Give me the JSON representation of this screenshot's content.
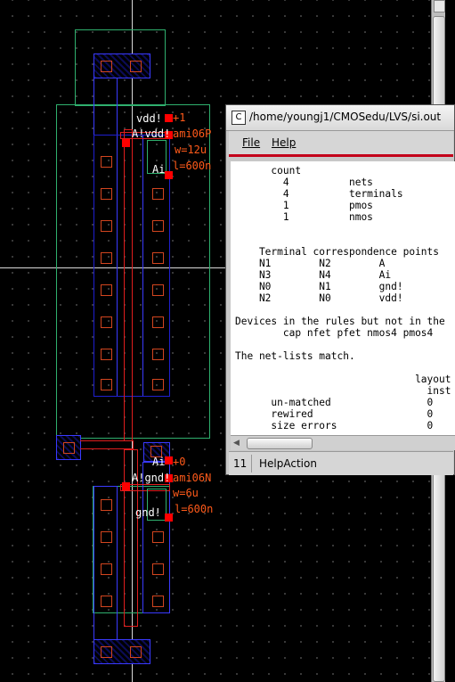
{
  "layout_labels": {
    "pmos_name": "vdd!",
    "pmos_index": "+1",
    "pmos_conn": "A!vdd!",
    "pmos_model": "ami06P",
    "pmos_width": "w=12u",
    "pmos_length": "l=600n",
    "pmos_gate": "Ai",
    "nmos_gate": "Ai",
    "nmos_index": "+0",
    "nmos_conn": "A!gnd!",
    "nmos_model": "ami06N",
    "nmos_width": "w=6u",
    "nmos_length": "l=600n",
    "nmos_name": "gnd!"
  },
  "window": {
    "title": "/home/youngj1/CMOSedu/LVS/si.out",
    "menu": {
      "file": "File",
      "help": "Help"
    },
    "content": "      count\n        4          nets\n        4          terminals\n        1          pmos\n        1          nmos\n\n\n    Terminal correspondence points\n    N1        N2        A\n    N3        N4        Ai\n    N0        N1        gnd!\n    N2        N0        vdd!\n\nDevices in the rules but not in the\n        cap nfet pfet nmos4 pmos4\n\nThe net-lists match.\n\n                              layout\n                                inst\n      un-matched                0\n      rewired                   0\n      size errors               0",
    "status_number": "11",
    "status_text": "HelpAction"
  },
  "colors": {
    "nwell": "#2fb06e",
    "poly": "#e01e1e",
    "active": "#1f1fcf",
    "metal": "#3a3aff",
    "label": "#ff5a1a",
    "pin": "#ff0000"
  }
}
